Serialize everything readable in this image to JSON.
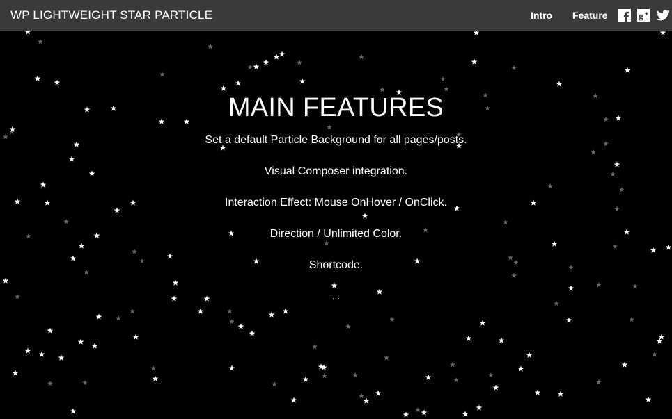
{
  "header": {
    "brand": "WP LIGHTWEIGHT STAR PARTICLE",
    "nav": [
      {
        "label": "Intro"
      },
      {
        "label": "Feature"
      }
    ],
    "social": [
      {
        "icon": "facebook-icon"
      },
      {
        "icon": "google-plus-icon"
      },
      {
        "icon": "twitter-icon"
      }
    ]
  },
  "main": {
    "title": "MAIN FEATURES",
    "features": [
      "Set a default Particle Background for all pages/posts.",
      "Visual Composer integration.",
      "Interaction Effect: Mouse OnHover / OnClick.",
      "Direction / Unlimited Color.",
      "Shortcode."
    ],
    "more": "..."
  },
  "colors": {
    "background": "#000000",
    "navbar": "#3a3a3a",
    "text": "#ffffff",
    "star_bright": "#ffffff",
    "star_dim": "#6b6b6b"
  }
}
